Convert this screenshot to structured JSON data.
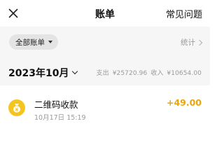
{
  "header": {
    "close_icon": "close-icon",
    "title": "账单",
    "faq_label": "常见问题"
  },
  "filter": {
    "chip_label": "全部账单",
    "chip_icon": "caret-down-icon",
    "stats_label": "统计",
    "stats_icon": "chevron-right-icon"
  },
  "month": {
    "label": "2023年10月",
    "chevron_icon": "chevron-down-icon",
    "expense_label": "支出",
    "expense_value": "¥25720.96",
    "income_label": "收入",
    "income_value": "¥10654.00"
  },
  "transactions": [
    {
      "icon": "money-bag-icon",
      "title": "二维码收款",
      "time": "10月17日 15:19",
      "amount": "+49.00"
    }
  ],
  "colors": {
    "accent": "#e9a50d",
    "icon_bg": "#f5c51f",
    "panel_bg": "#f6f6f6"
  }
}
